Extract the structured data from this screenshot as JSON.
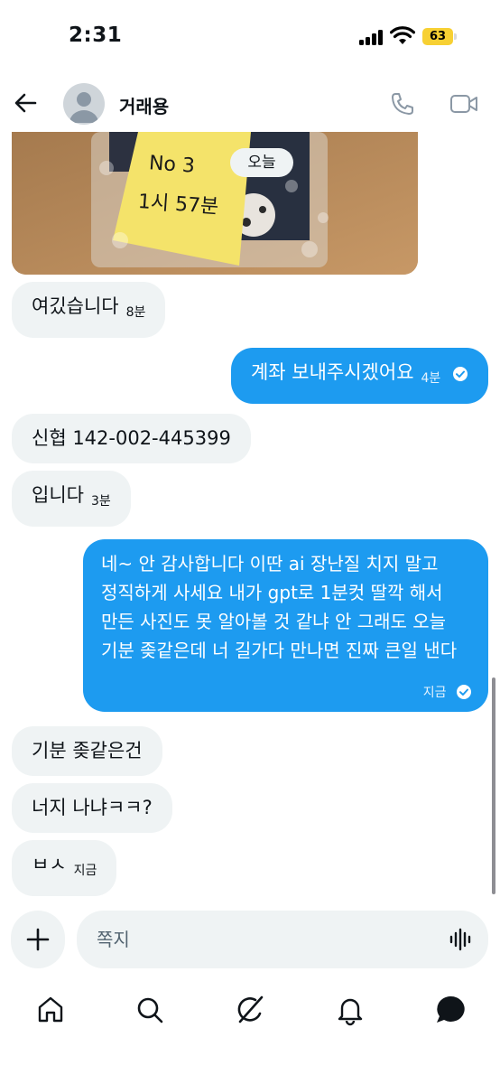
{
  "status_bar": {
    "time": "2:31",
    "battery": "63"
  },
  "header": {
    "contact_name": "거래용"
  },
  "photo": {
    "note_lines": [
      "No 3",
      "1시 57분"
    ],
    "date_pill": "오늘"
  },
  "messages": [
    {
      "side": "in",
      "text": "여깄습니다",
      "time": "8분"
    },
    {
      "side": "out",
      "text": "계좌 보내주시겠어요",
      "time": "4분"
    },
    {
      "side": "in",
      "text": "신협 142-002-445399",
      "time": ""
    },
    {
      "side": "in",
      "text": "입니다",
      "time": "3분"
    },
    {
      "side": "out",
      "text": "네~ 안 감사합니다 이딴 ai 장난질 치지 말고 정직하게 사세요 내가 gpt로 1분컷 딸깍 해서 만든 사진도 못 알아볼 것 같냐 안 그래도 오늘 기분 좆같은데 너 길가다 만나면 진짜 큰일 낸다",
      "time": "지금"
    },
    {
      "side": "in",
      "text": "기분 좆같은건",
      "time": ""
    },
    {
      "side": "in",
      "text": "너지 나냐ㅋㅋ?",
      "time": ""
    },
    {
      "side": "in",
      "text": "ㅂㅅ",
      "time": "지금"
    }
  ],
  "composer": {
    "placeholder": "쪽지"
  },
  "colors": {
    "accent": "#1d9bf0",
    "bubble_in": "#eff3f4",
    "battery": "#f7d033"
  },
  "icons": [
    "back-arrow-icon",
    "phone-icon",
    "video-icon",
    "plus-icon",
    "voice-icon",
    "home-icon",
    "search-icon",
    "grok-icon",
    "bell-icon",
    "messages-icon"
  ]
}
